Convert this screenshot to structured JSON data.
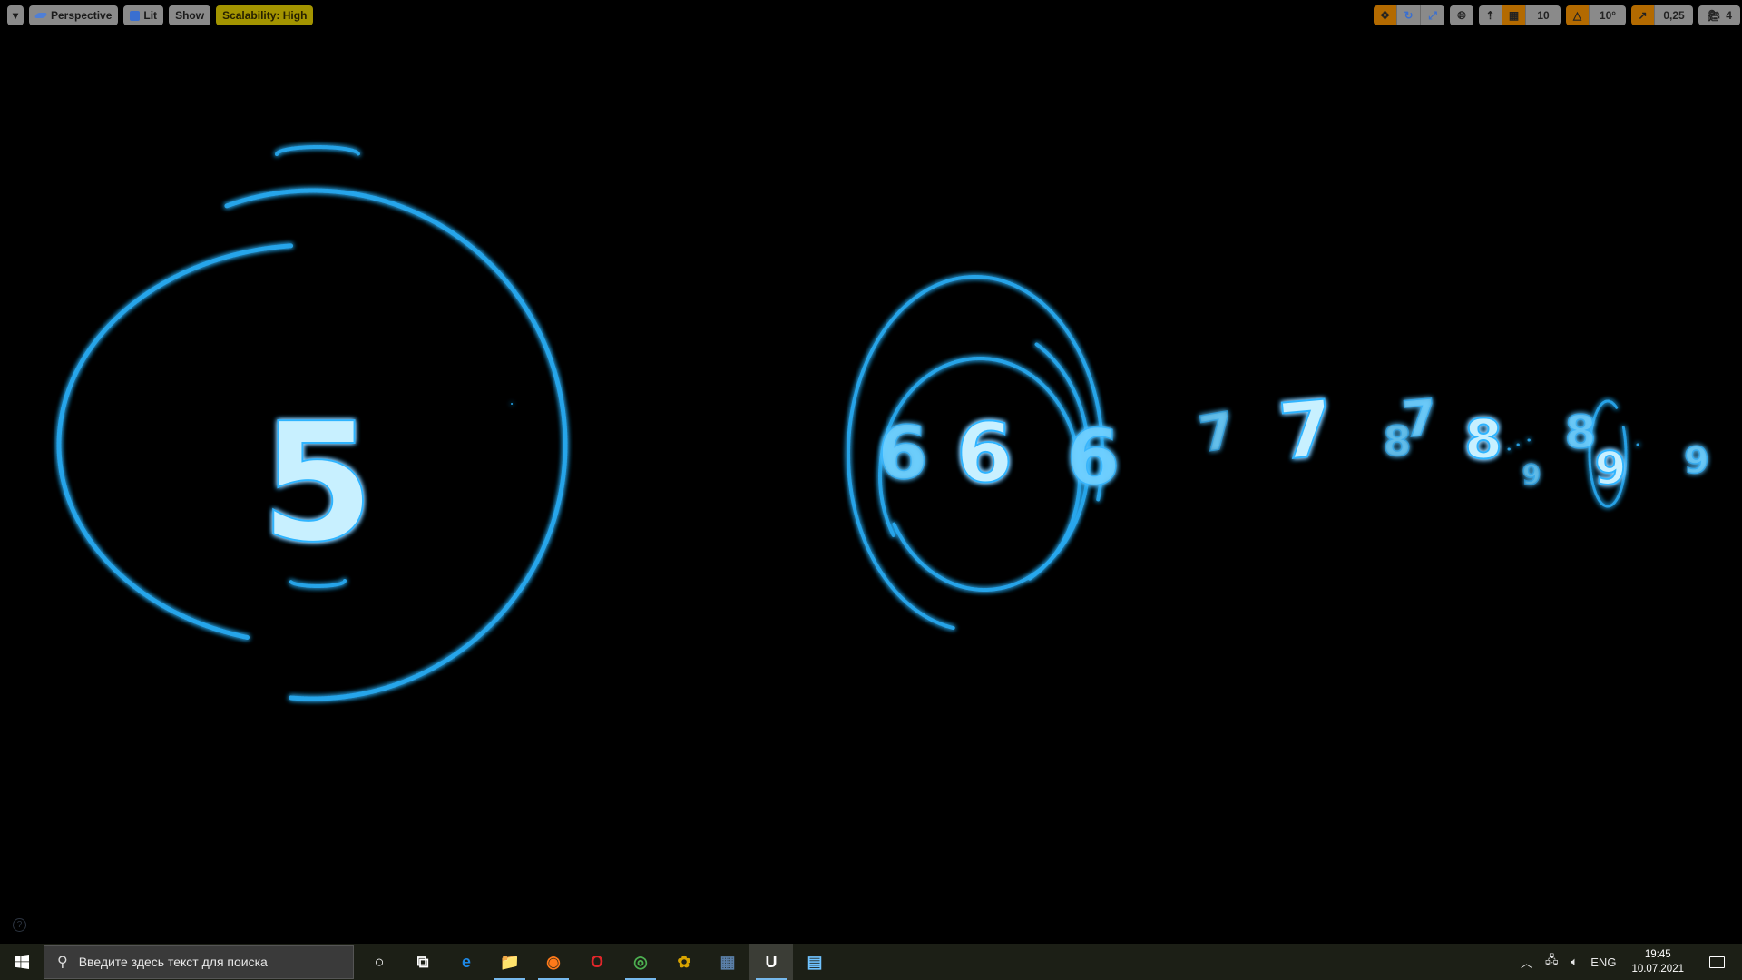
{
  "viewport": {
    "toolbar_left": {
      "menu_button": "▾",
      "view_mode": "Perspective",
      "view_mode_icon": "perspective-icon",
      "lighting": "Lit",
      "lighting_icon": "lit-cube-icon",
      "show": "Show",
      "scalability": "Scalability: High"
    },
    "toolbar_right": {
      "transform_tools": [
        "translate-icon",
        "rotate-icon",
        "scale-icon"
      ],
      "active_transform": "translate",
      "coordinate_space_icon": "world-globe-icon",
      "surface_snap_icon": "surface-snap-icon",
      "grid_snap_enabled": true,
      "grid_snap_value": "10",
      "rotation_snap_enabled": true,
      "rotation_snap_value": "10°",
      "scale_snap_enabled": true,
      "scale_snap_value": "0,25",
      "camera_speed_value": "4",
      "maximize_icon": "maximize-viewport-icon"
    },
    "help_icon": "?",
    "scene": {
      "description": "Blue particle-effect numerals with orbiting rings",
      "glow_color": "#2fb4ff",
      "core_color": "#c8f0ff",
      "numerals": [
        {
          "text": "5",
          "role": "main"
        },
        {
          "text": "6",
          "role": "main"
        },
        {
          "text": "6",
          "role": "ghost"
        },
        {
          "text": "6",
          "role": "ghost"
        },
        {
          "text": "7",
          "role": "main"
        },
        {
          "text": "7",
          "role": "ghost"
        },
        {
          "text": "7",
          "role": "ghost"
        },
        {
          "text": "8",
          "role": "main"
        },
        {
          "text": "8",
          "role": "ghost"
        },
        {
          "text": "8",
          "role": "ghost"
        },
        {
          "text": "9",
          "role": "main"
        },
        {
          "text": "9",
          "role": "ghost"
        },
        {
          "text": "9",
          "role": "ghost"
        }
      ]
    }
  },
  "taskbar": {
    "search_placeholder": "Введите здесь текст для поиска",
    "apps": [
      {
        "name": "cortana",
        "glyph": "○",
        "running": false,
        "active": false
      },
      {
        "name": "task-view",
        "glyph": "⧉",
        "running": false,
        "active": false
      },
      {
        "name": "edge",
        "glyph": "e",
        "running": false,
        "active": false
      },
      {
        "name": "file-explorer",
        "glyph": "📁",
        "running": true,
        "active": false
      },
      {
        "name": "firefox",
        "glyph": "◉",
        "running": true,
        "active": false
      },
      {
        "name": "opera",
        "glyph": "O",
        "running": false,
        "active": false
      },
      {
        "name": "chrome",
        "glyph": "◎",
        "running": true,
        "active": false
      },
      {
        "name": "fl-studio",
        "glyph": "✿",
        "running": false,
        "active": false
      },
      {
        "name": "calculator",
        "glyph": "▦",
        "running": false,
        "active": false
      },
      {
        "name": "unreal-engine",
        "glyph": "U",
        "running": true,
        "active": true
      },
      {
        "name": "film-app",
        "glyph": "▤",
        "running": false,
        "active": false
      }
    ],
    "tray": {
      "chevron": "^",
      "network_icon": "network-icon",
      "volume_icon": "volume-icon",
      "language": "ENG",
      "time": "19:45",
      "date": "10.07.2021",
      "notifications_icon": "notifications-icon"
    }
  }
}
